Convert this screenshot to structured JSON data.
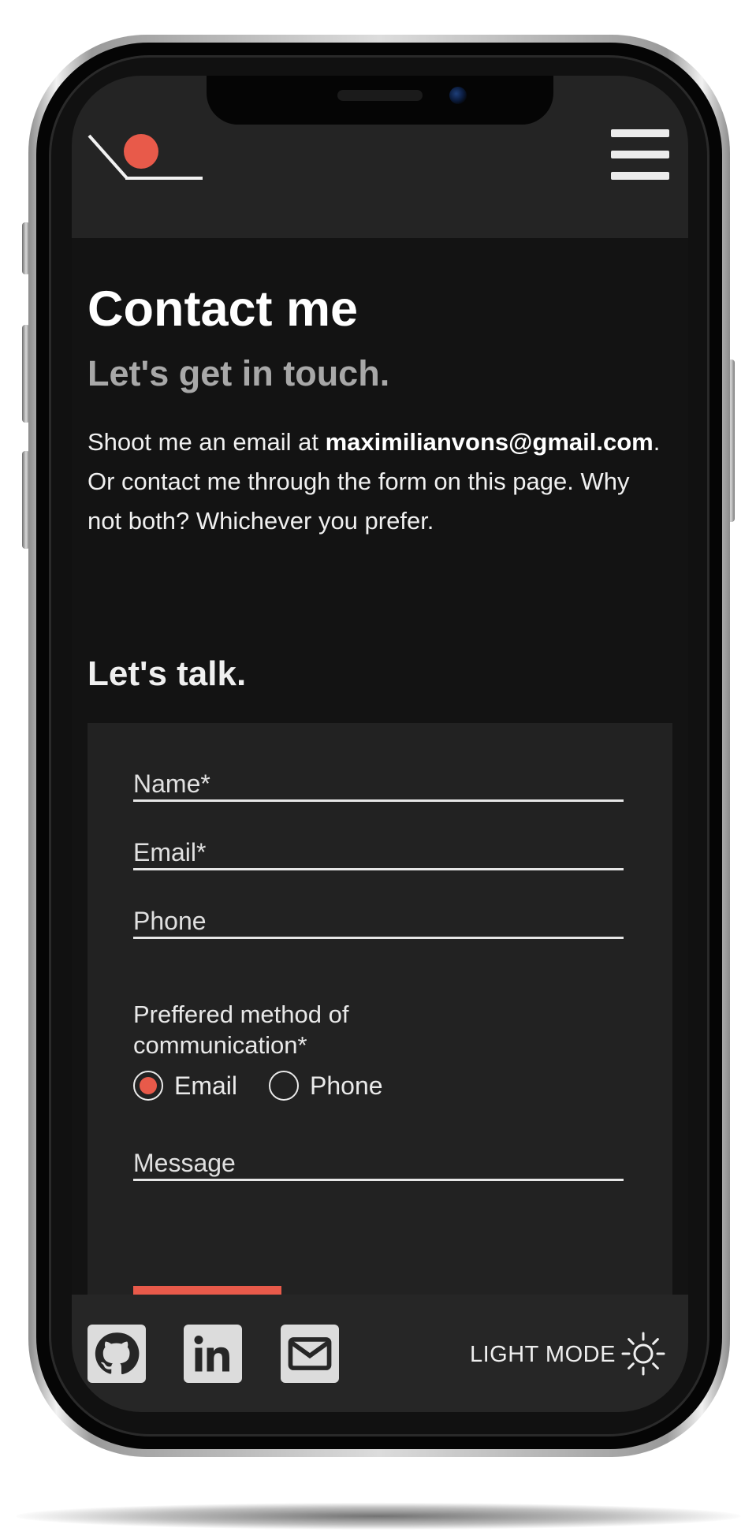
{
  "header": {
    "logo_icon": "ball-ramp-logo",
    "menu_icon": "hamburger-menu-icon"
  },
  "main": {
    "title": "Contact me",
    "subtitle": "Let's get in touch.",
    "intro_before": "Shoot me an email at ",
    "email": "maximilianvons@gmail.com",
    "intro_after": ". Or contact me through the form on this page. Why not both? Whichever you prefer.",
    "section_title": "Let's talk."
  },
  "form": {
    "name_placeholder": "Name*",
    "email_placeholder": "Email*",
    "phone_placeholder": "Phone",
    "preferred_label": "Preffered method of communication*",
    "options": [
      {
        "label": "Email",
        "selected": true
      },
      {
        "label": "Phone",
        "selected": false
      }
    ],
    "message_placeholder": "Message"
  },
  "footer": {
    "social": [
      "github-icon",
      "linkedin-icon",
      "mail-icon"
    ],
    "mode_label": "LIGHT MODE",
    "mode_icon": "sun-icon"
  },
  "colors": {
    "accent": "#e85a4a",
    "background": "#131313",
    "header_bg": "#242424",
    "card_bg": "#222222"
  }
}
